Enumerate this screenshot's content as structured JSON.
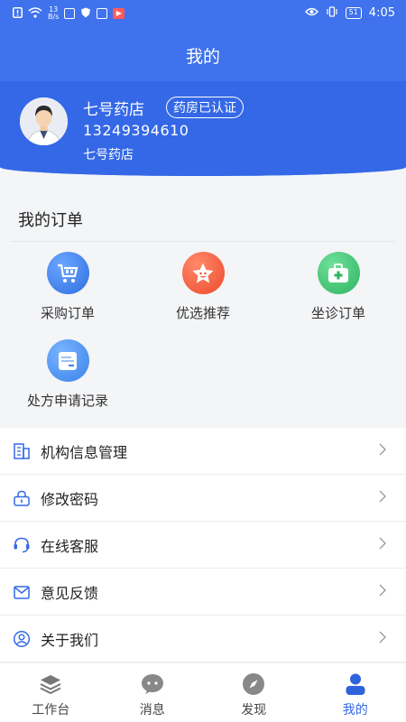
{
  "status_bar": {
    "net_speed_top": "13",
    "net_speed_bottom": "B/s",
    "battery": "51",
    "time": "4:05"
  },
  "header": {
    "title": "我的"
  },
  "profile": {
    "shop_name": "七号药店",
    "badge": "药房已认证",
    "phone": "13249394610",
    "sub_name": "七号药店"
  },
  "orders": {
    "title": "我的订单",
    "items": [
      {
        "label": "采购订单",
        "icon": "cart-icon",
        "color": "#3d7ff0"
      },
      {
        "label": "优选推荐",
        "icon": "star-icon",
        "color": "#f25a3a"
      },
      {
        "label": "坐诊订单",
        "icon": "medkit-icon",
        "color": "#3dbf6e"
      },
      {
        "label": "处方申请记录",
        "icon": "document-icon",
        "color": "#4a90ee"
      }
    ]
  },
  "menu": {
    "items": [
      {
        "label": "机构信息管理",
        "icon": "building-icon"
      },
      {
        "label": "修改密码",
        "icon": "lock-icon"
      },
      {
        "label": "在线客服",
        "icon": "headset-icon"
      },
      {
        "label": "意见反馈",
        "icon": "mail-icon"
      },
      {
        "label": "关于我们",
        "icon": "user-circle-icon"
      }
    ]
  },
  "tabbar": {
    "items": [
      {
        "label": "工作台",
        "icon": "layers-icon"
      },
      {
        "label": "消息",
        "icon": "chat-icon"
      },
      {
        "label": "发现",
        "icon": "compass-icon"
      },
      {
        "label": "我的",
        "icon": "person-icon",
        "active": true
      }
    ]
  },
  "colors": {
    "primary": "#3468e6",
    "header": "#3f72ec"
  }
}
